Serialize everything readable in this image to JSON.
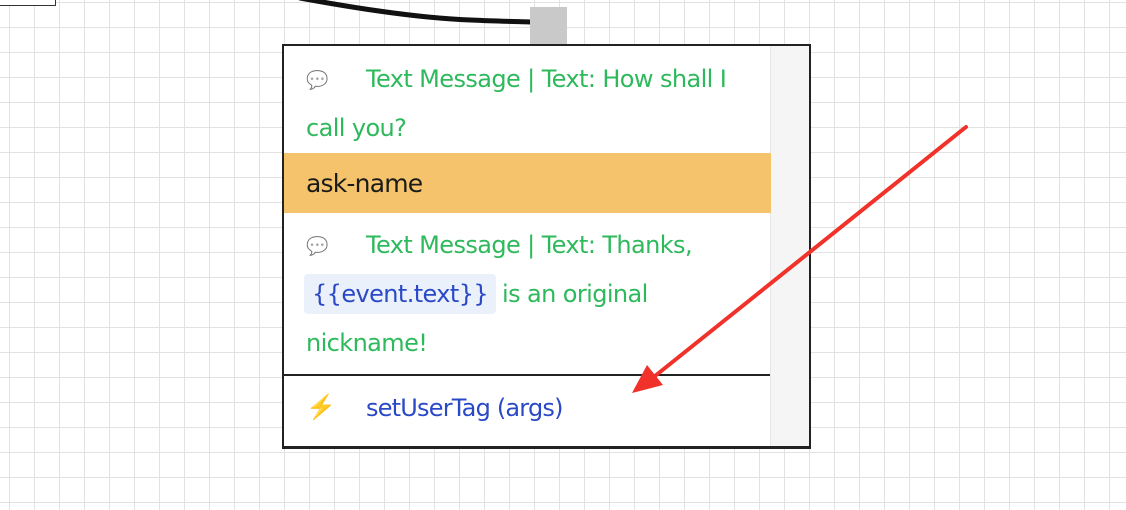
{
  "node": {
    "label": "ask-name",
    "message1": {
      "icon": "speech-bubble-icon",
      "text": "Text Message | Text: How shall I call you?"
    },
    "message2": {
      "icon": "speech-bubble-icon",
      "text_before": "Text Message | Text: Thanks,",
      "variable": "{{event.text}}",
      "text_after": "is an original nickname!"
    },
    "action": {
      "icon": "lightning-bolt-icon",
      "text": "setUserTag (args)"
    }
  },
  "colors": {
    "message_text": "#2eb95c",
    "action_text": "#2b49c7",
    "label_bar": "#f4c36c",
    "arrow": "#f0322a",
    "bolt": "#f0b330"
  }
}
